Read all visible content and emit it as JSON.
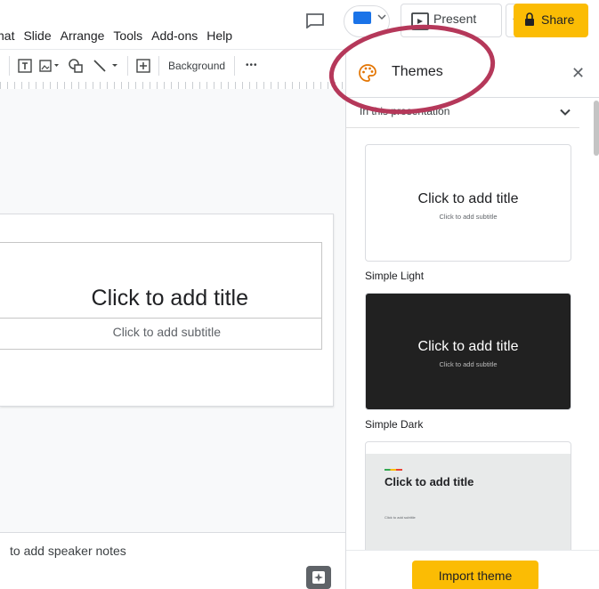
{
  "menu": [
    "nat",
    "Slide",
    "Arrange",
    "Tools",
    "Add-ons",
    "Help"
  ],
  "header": {
    "present_label": "Present",
    "share_label": "Share"
  },
  "toolbar": {
    "background_label": "Background",
    "more_label": "•••"
  },
  "slide": {
    "title": "Click to add title",
    "subtitle": "Click to add subtitle"
  },
  "notes": {
    "placeholder": "to add speaker notes"
  },
  "themes_panel": {
    "title": "Themes",
    "filter_label": "In this presentation",
    "themes": [
      {
        "name": "Simple Light",
        "title": "Click to add title",
        "subtitle": "Click to add subtitle"
      },
      {
        "name": "Simple Dark",
        "title": "Click to add title",
        "subtitle": "Click to add subtitle"
      },
      {
        "name": "",
        "title": "Click to add title",
        "subtitle": "Click to add subtitle"
      }
    ],
    "import_button": "Import theme"
  },
  "colors": {
    "accent_yellow": "#fbbc04",
    "annotation": "#b5385a",
    "dark_theme_bg": "#212121"
  },
  "icons": [
    "comment-icon",
    "camera-icon",
    "present-icon",
    "share-lock-icon",
    "text-box-icon",
    "image-icon",
    "shape-icon",
    "line-icon",
    "new-comment-icon",
    "palette-icon",
    "close-icon",
    "chevron-down-icon",
    "explore-icon"
  ]
}
